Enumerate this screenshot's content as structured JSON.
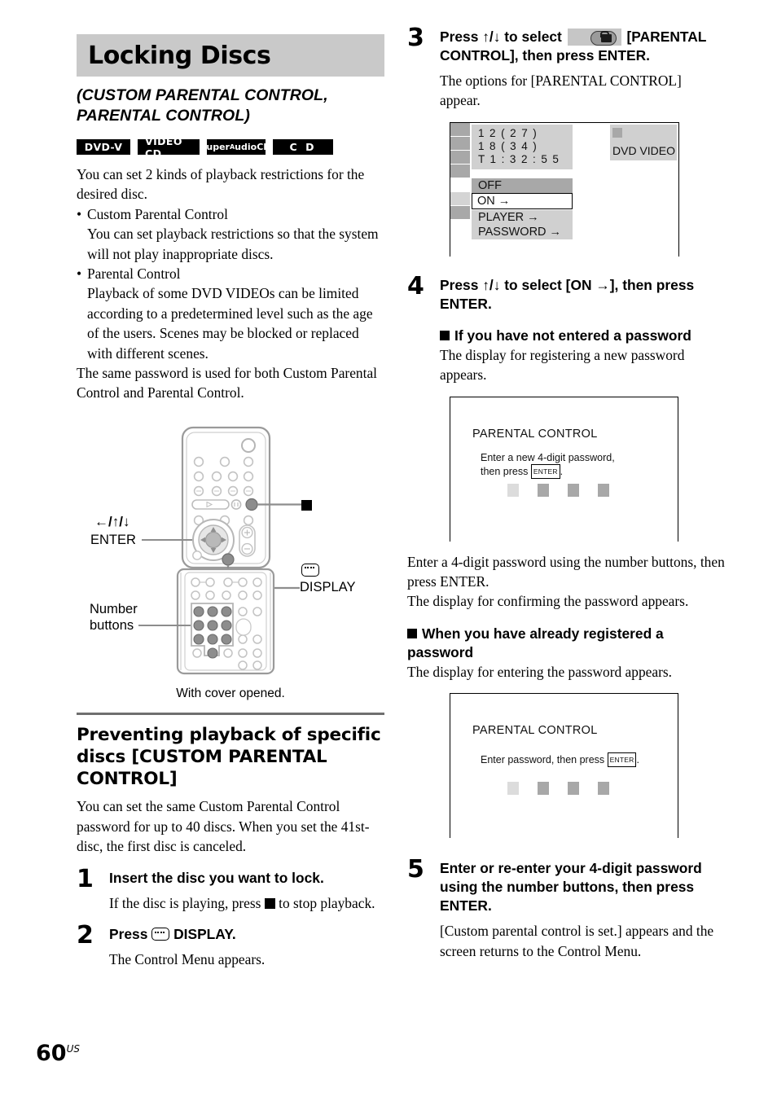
{
  "chapter": {
    "title": "Locking Discs",
    "subtitle": "(CUSTOM PARENTAL CONTROL, PARENTAL CONTROL)"
  },
  "badges": [
    {
      "id": "dvd-v",
      "label": "DVD-V"
    },
    {
      "id": "video-cd",
      "label": "VIDEO CD"
    },
    {
      "id": "super-audio-cd",
      "label": "SuperAudioCD"
    },
    {
      "id": "cd",
      "label": "C D"
    }
  ],
  "intro": {
    "lead": "You can set 2 kinds of playback restrictions for the desired disc.",
    "bullet1_title": "Custom Parental Control",
    "bullet1_body": "You can set playback restrictions so that the system will not play inappropriate discs.",
    "bullet2_title": "Parental Control",
    "bullet2_body": "Playback of some DVD VIDEOs can be limited according to a predetermined level such as the age of the users. Scenes may be blocked or replaced with different scenes.",
    "closing": "The same password is used for both Custom Parental Control and Parental Control."
  },
  "remote": {
    "label_arrows": "←/↑/↓",
    "label_enter": "ENTER",
    "label_number_line1": "Number",
    "label_number_line2": "buttons",
    "label_display": "DISPLAY",
    "caption": "With cover opened."
  },
  "section": {
    "heading": "Preventing playback of specific discs [CUSTOM PARENTAL CONTROL]",
    "intro": "You can set the same Custom Parental Control password for up to 40 discs. When you set the 41st-disc, the first disc is canceled."
  },
  "steps": [
    {
      "num": "1",
      "head": "Insert the disc you want to lock.",
      "sub_before": "If the disc is playing, press",
      "sub_after": "to stop playback."
    },
    {
      "num": "2",
      "head_before": "Press",
      "head_after": "DISPLAY.",
      "sub": "The Control Menu appears."
    },
    {
      "num": "3",
      "head_before": "Press ↑/↓ to select",
      "head_after": "[PARENTAL CONTROL], then press ENTER.",
      "sub": "The options for [PARENTAL CONTROL] appear."
    },
    {
      "num": "4",
      "head": "Press ↑/↓ to select [ON →], then press ENTER.",
      "block1_head": "If you have not entered a password",
      "block1_body": "The display for registering a new password appears.",
      "after_dialog_1": "Enter a 4-digit password using the number buttons, then press ENTER.",
      "after_dialog_2": "The display for confirming the password appears.",
      "block2_head": "When you have already registered a password",
      "block2_body": "The display for entering the password appears."
    },
    {
      "num": "5",
      "head": "Enter or re-enter your 4-digit password using the number buttons, then press ENTER.",
      "sub": "[Custom parental control is set.] appears and the screen returns to the Control Menu."
    }
  ],
  "osd": {
    "line1": "1 2 ( 2 7 )",
    "line2": "1 8 ( 3 4 )",
    "line3": "T    1 : 3 2 : 5 5",
    "disc_type": "DVD VIDEO",
    "options": [
      {
        "label": "OFF",
        "state": "highlighted"
      },
      {
        "label": "ON →",
        "state": "selected"
      },
      {
        "label": "PLAYER →",
        "state": "normal"
      },
      {
        "label": "PASSWORD →",
        "state": "normal"
      }
    ]
  },
  "dialog_new_password": {
    "title": "PARENTAL CONTROL",
    "msg_line1": "Enter a new 4-digit password,",
    "msg_line2_before": "then press",
    "enter_key": "ENTER",
    "msg_line2_after": ".",
    "digit_count": 4
  },
  "dialog_enter_password": {
    "title": "PARENTAL CONTROL",
    "msg_before": "Enter password, then press",
    "enter_key": "ENTER",
    "msg_after": ".",
    "digit_count": 4
  },
  "footer": {
    "page_number": "60",
    "page_suffix": "US"
  }
}
